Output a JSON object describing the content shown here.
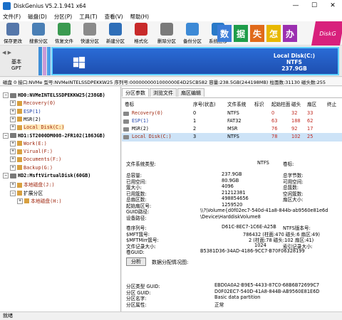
{
  "window": {
    "title": "DiskGenius V5.2.1.941 x64",
    "min": "—",
    "max": "☐",
    "close": "✕"
  },
  "menu": [
    "文件(F)",
    "磁盘(D)",
    "分区(P)",
    "工具(T)",
    "查看(V)",
    "帮助(H)"
  ],
  "toolbar": [
    {
      "label": "保存更改",
      "icon": "save-icon",
      "color": "#5577aa"
    },
    {
      "label": "搜索分区",
      "icon": "search-icon",
      "color": "#4a7fb5"
    },
    {
      "label": "恢复文件",
      "icon": "recover-icon",
      "color": "#3a9a50"
    },
    {
      "label": "快速分区",
      "icon": "quick-partition-icon",
      "color": "#8a8a8a"
    },
    {
      "label": "新建分区",
      "icon": "new-partition-icon",
      "color": "#2f6fb8"
    },
    {
      "label": "格式化",
      "icon": "format-icon",
      "color": "#c82a2a"
    },
    {
      "label": "删除分区",
      "icon": "delete-icon",
      "color": "#7a7a7a"
    },
    {
      "label": "备份分区",
      "icon": "backup-icon",
      "color": "#3d8ad6"
    },
    {
      "label": "系统迁移",
      "icon": "migrate-icon",
      "color": "#2a7ac8"
    }
  ],
  "banner": {
    "chars": [
      "数",
      "据",
      "失",
      "怎",
      "办"
    ],
    "colors": [
      "#3b7dd8",
      "#1e9d4a",
      "#e06a1a",
      "#e8b800",
      "#9b2fb0"
    ],
    "brand": "DiskG"
  },
  "diskmap": {
    "label_line1": "基本",
    "label_line2": "GPT",
    "partition": {
      "name": "Local Disk(C:)",
      "fs": "NTFS",
      "size": "237.9GB"
    },
    "small_bars": [
      "#3f8fd8",
      "#c89ad8",
      "#4fa0e8"
    ]
  },
  "diskinfo": "磁盘 0 接口:NVMe  型号:NVMeINTELSSDPEKKW25  序列号:0000000001000000E4D25CB582  容量:238.5GB(244198MB)  柱面数:31130  磁头数:255",
  "tree": [
    {
      "type": "disk",
      "label": "HD0:NVMeINTELSSDPEKKW25(238GB)",
      "indent": 0,
      "toggle": "−",
      "bold": true
    },
    {
      "type": "part",
      "label": "Recovery(0)",
      "indent": 1,
      "color": "brown",
      "toggle": "+"
    },
    {
      "type": "part",
      "label": "ESP(1)",
      "indent": 1,
      "color": "blue",
      "toggle": "+"
    },
    {
      "type": "part",
      "label": "MSR(2)",
      "indent": 1,
      "color": "black",
      "toggle": "+"
    },
    {
      "type": "part",
      "label": "Local Disk(C:)",
      "indent": 1,
      "color": "brown",
      "toggle": "+"
    },
    {
      "type": "disk",
      "label": "HD1:ST2000DM008-2FR102(1863GB)",
      "indent": 0,
      "toggle": "−",
      "bold": true
    },
    {
      "type": "part",
      "label": "Work(E:)",
      "indent": 1,
      "color": "brown",
      "toggle": "+"
    },
    {
      "type": "part",
      "label": "Virual(F:)",
      "indent": 1,
      "color": "brown",
      "toggle": "+"
    },
    {
      "type": "part",
      "label": "Documents(F:)",
      "indent": 1,
      "color": "brown",
      "toggle": "+"
    },
    {
      "type": "part",
      "label": "Backup(G:)",
      "indent": 1,
      "color": "brown",
      "toggle": "+"
    },
    {
      "type": "disk",
      "label": "HD2:MsftVirtualDisk(60GB)",
      "indent": 0,
      "toggle": "−",
      "bold": true
    },
    {
      "type": "part",
      "label": "本地磁盘(J:)",
      "indent": 1,
      "color": "brown",
      "toggle": "+"
    },
    {
      "type": "part",
      "label": "扩展分区",
      "indent": 1,
      "color": "black",
      "toggle": "−"
    },
    {
      "type": "part",
      "label": "本地磁盘(H:)",
      "indent": 2,
      "color": "brown",
      "toggle": "+"
    }
  ],
  "tabs": [
    "分区参数",
    "浏览文件",
    "扇区编辑"
  ],
  "ptable": {
    "headers": [
      "卷标",
      "序号(状态)",
      "文件系统",
      "标识",
      "起始柱面",
      "磁头",
      "扇区",
      "终止"
    ],
    "rows": [
      [
        "Recovery(0)",
        "0",
        "NTFS",
        "",
        "0",
        "32",
        "33",
        ""
      ],
      [
        "ESP(1)",
        "1",
        "FAT32",
        "",
        "63",
        "188",
        "62",
        ""
      ],
      [
        "MSR(2)",
        "2",
        "MSR",
        "",
        "76",
        "92",
        "17",
        ""
      ],
      [
        "Local Disk(C:)",
        "3",
        "NTFS",
        "",
        "78",
        "102",
        "25",
        ""
      ]
    ]
  },
  "details": {
    "fs_type_label": "文件系统类型:",
    "fs_type": "NTFS",
    "vol_label": "卷标:",
    "left": [
      [
        "总容量:",
        "237.9GB"
      ],
      [
        "已用空间:",
        "80.9GB"
      ],
      [
        "簇大小:",
        "4096"
      ],
      [
        "已用簇数:",
        "21212381"
      ],
      [
        "总扇区数:",
        "498854656"
      ],
      [
        "起始扇区号:",
        "1259520"
      ]
    ],
    "right": [
      [
        "总字节数:",
        ""
      ],
      [
        "可用空间:",
        ""
      ],
      [
        "总簇数:",
        ""
      ],
      [
        "空闲簇数:",
        ""
      ],
      [
        "扇区大小:",
        ""
      ],
      [
        "",
        ""
      ]
    ],
    "guid_path_label": "GUID路径:",
    "guid_path": "\\\\?\\Volume{d0f02ec7-540d-41a8-844b-ab9560e81e6d",
    "device_path_label": "设备路径:",
    "device_path": "\\Device\\HarddiskVolume8",
    "serial_label": "卷序列号:",
    "serial": "D61C-8EC7-1C6E-A25B",
    "ntfs_ver_label": "NTFS版本号:",
    "mft_label": "$MFT簇号:",
    "mft": "786432 (柱面:470 磁头:6 扇区:49)",
    "mftmirr_label": "$MFTMirr簇号:",
    "mftmirr": "2 (柱面:78 磁头:102 扇区:41)",
    "rec_size_label": "文件记录大小:",
    "rec_size": "1024",
    "idx_size_label": "索引记录大小:",
    "vol_guid_label": "卷GUID:",
    "vol_guid": "B5381D36-34AD-4186-9CC7-B70F06328199",
    "analyze_btn": "分析",
    "analyze_label": "数据分配情况图:",
    "type_guid_label": "分区类型 GUID:",
    "type_guid": "EBD0A0A2-B9E5-4433-87C0-68B6B72699C7",
    "part_guid_label": "分区 GUID:",
    "part_guid": "D0F02EC7-540D-41A8-844B-AB9560E81E6D",
    "part_name_label": "分区名字:",
    "part_name": "Basic data partition",
    "part_attr_label": "分区属性:",
    "part_attr": "正常"
  },
  "status": "就绪"
}
